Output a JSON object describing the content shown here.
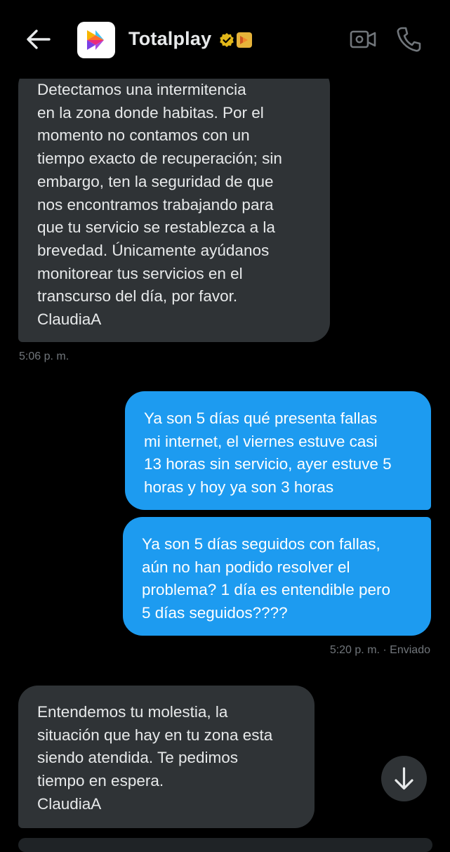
{
  "header": {
    "title": "Totalplay",
    "icons": {
      "back": "arrow-left-icon",
      "verified": "verified-badge-icon",
      "affiliate": "affiliate-badge-icon",
      "video": "video-call-icon",
      "phone": "phone-call-icon"
    }
  },
  "messages": [
    {
      "direction": "in",
      "lines": [
        "Detectamos una intermitencia",
        "en la zona donde habitas. Por el",
        "momento no contamos con un",
        "tiempo exacto de recuperación; sin",
        "embargo, ten la seguridad de que",
        "nos encontramos trabajando para",
        "que tu servicio se restablezca a la",
        "brevedad. Únicamente ayúdanos",
        "monitorear tus servicios en el",
        "transcurso del día, por favor.",
        "ClaudiaA"
      ],
      "time": "5:06 p. m."
    },
    {
      "direction": "out",
      "lines": [
        "Ya son 5 días qué presenta fallas",
        "mi internet, el viernes estuve casi",
        "13 horas sin servicio, ayer estuve 5",
        "horas y hoy ya son 3 horas"
      ]
    },
    {
      "direction": "out",
      "lines": [
        "Ya son 5 días seguidos con fallas,",
        "aún no han podido resolver el",
        "problema? 1 día es entendible pero",
        "5 días seguidos????"
      ],
      "time": "5:20 p. m. · Enviado"
    },
    {
      "direction": "in",
      "lines": [
        "Entendemos tu molestia, la",
        "situación que hay en tu zona esta",
        "siendo atendida. Te pedimos",
        "tiempo en espera.",
        "ClaudiaA"
      ]
    }
  ],
  "scroll_button": {
    "icon": "arrow-down-icon"
  },
  "colors": {
    "background": "#000000",
    "incoming_bubble": "#2f3336",
    "outgoing_bubble": "#1d9bf0",
    "timestamp": "#71767b"
  }
}
